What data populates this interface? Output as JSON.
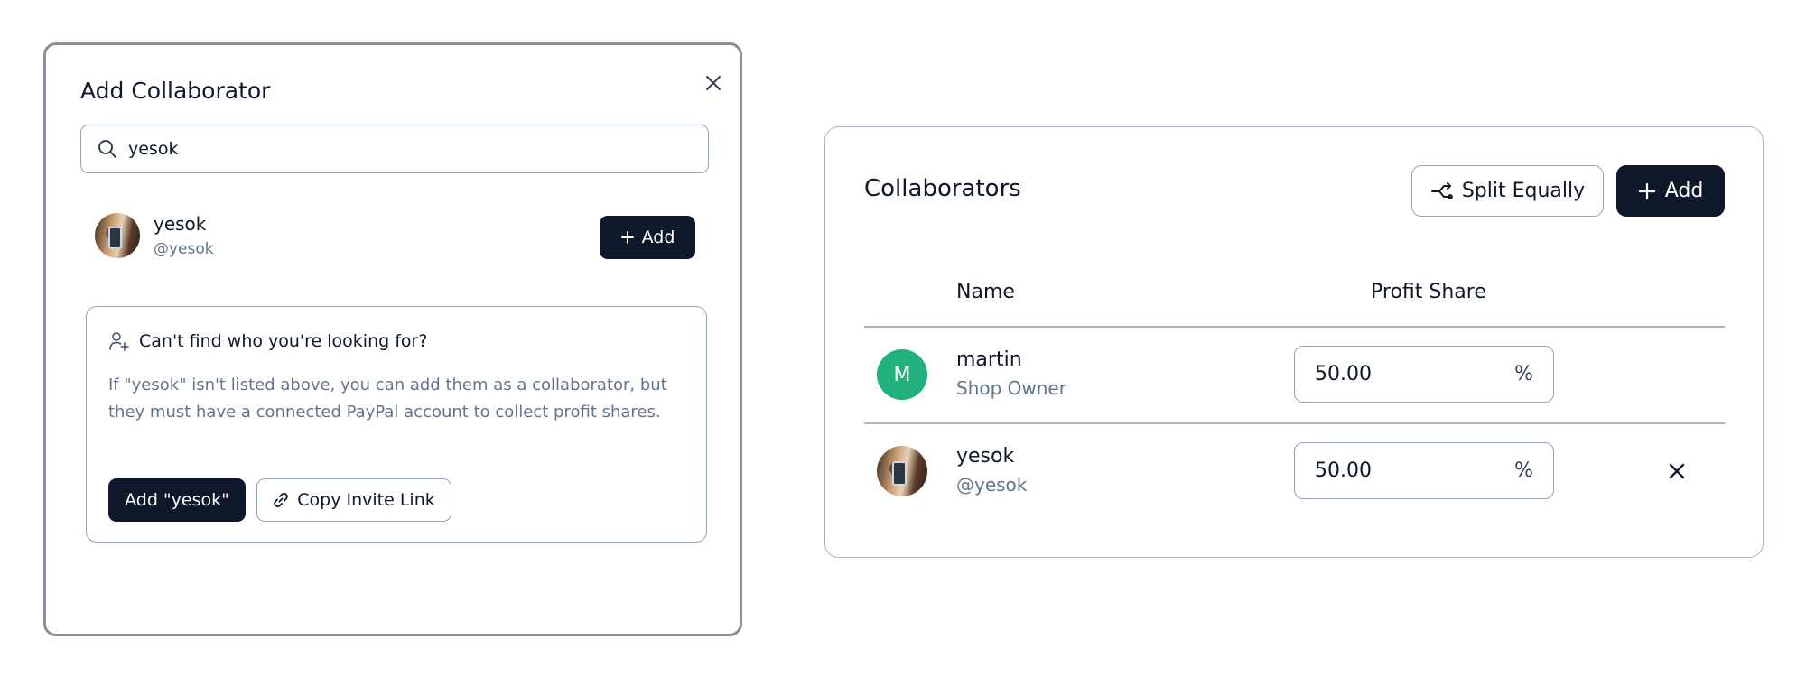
{
  "modal": {
    "title": "Add Collaborator",
    "search": {
      "value": "yesok",
      "placeholder": ""
    },
    "result": {
      "name": "yesok",
      "handle": "@yesok",
      "add_label": "Add"
    },
    "not_found": {
      "heading": "Can't find who you're looking for?",
      "body": "If \"yesok\" isn't listed above, you can add them as a collaborator, but they must have a connected PayPal account to collect profit shares.",
      "add_label": "Add \"yesok\"",
      "copy_label": "Copy Invite Link"
    }
  },
  "collaborators": {
    "title": "Collaborators",
    "split_label": "Split Equally",
    "add_label": "Add",
    "columns": {
      "name": "Name",
      "share": "Profit Share"
    },
    "rows": [
      {
        "initial": "M",
        "name": "martin",
        "subtitle": "Shop Owner",
        "share": "50.00",
        "unit": "%",
        "avatar_color": "#22b07d"
      },
      {
        "initial": "",
        "name": "yesok",
        "subtitle": "@yesok",
        "share": "50.00",
        "unit": "%"
      }
    ]
  },
  "colors": {
    "primary": "#0f172a",
    "muted": "#64748b",
    "border": "#94a3b8",
    "avatar_green": "#22b07d"
  },
  "icons": [
    "close-icon",
    "search-icon",
    "plus-icon",
    "user-plus-icon",
    "link-icon",
    "split-icon",
    "remove-icon"
  ]
}
